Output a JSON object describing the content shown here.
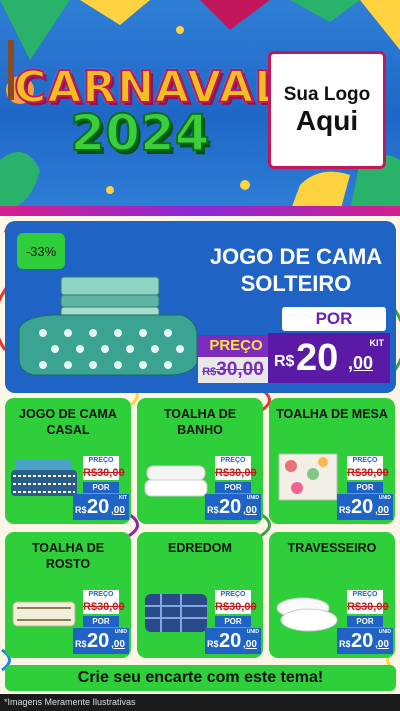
{
  "header": {
    "title": "CARNAVAL",
    "year": "2024",
    "logo_line1": "Sua Logo",
    "logo_line2": "Aqui"
  },
  "hero": {
    "discount_badge": "-33%",
    "title_line1": "JOGO DE CAMA",
    "title_line2": "SOLTEIRO",
    "por_label": "POR",
    "preco_label": "PREÇO",
    "old_currency": "R$",
    "old_price": "30,00",
    "currency": "R$",
    "price_int": "20",
    "price_dec": ",00",
    "unit": "KIT"
  },
  "products": [
    {
      "title": "JOGO DE CAMA CASAL",
      "preco_label": "PREÇO",
      "old_currency": "R$",
      "old_price": "30,00",
      "por_label": "POR",
      "currency": "R$",
      "price_int": "20",
      "price_dec": ",00",
      "unit": "KIT"
    },
    {
      "title": "TOALHA DE BANHO",
      "preco_label": "PREÇO",
      "old_currency": "R$",
      "old_price": "30,00",
      "por_label": "POR",
      "currency": "R$",
      "price_int": "20",
      "price_dec": ",00",
      "unit": "UNID"
    },
    {
      "title": "TOALHA DE MESA",
      "preco_label": "PREÇO",
      "old_currency": "R$",
      "old_price": "30,00",
      "por_label": "POR",
      "currency": "R$",
      "price_int": "20",
      "price_dec": ",00",
      "unit": "UNID"
    },
    {
      "title": "TOALHA DE ROSTO",
      "preco_label": "PREÇO",
      "old_currency": "R$",
      "old_price": "30,00",
      "por_label": "POR",
      "currency": "R$",
      "price_int": "20",
      "price_dec": ",00",
      "unit": "UNID"
    },
    {
      "title": "EDREDOM",
      "preco_label": "PREÇO",
      "old_currency": "R$",
      "old_price": "30,00",
      "por_label": "POR",
      "currency": "R$",
      "price_int": "20",
      "price_dec": ",00",
      "unit": "UNID"
    },
    {
      "title": "TRAVESSEIRO",
      "preco_label": "PREÇO",
      "old_currency": "R$",
      "old_price": "30,00",
      "por_label": "POR",
      "currency": "R$",
      "price_int": "20",
      "price_dec": ",00",
      "unit": "UNID"
    }
  ],
  "footer": {
    "cta": "Crie seu encarte com este tema!",
    "disclaimer": "*Imagens Meramente Ilustrativas"
  },
  "colors": {
    "header_blue": "#1f67c7",
    "card_green": "#2ecf3a",
    "hero_blue": "#1f63c4",
    "price_purple": "#5b1aa6",
    "accent_magenta": "#c2185b"
  }
}
